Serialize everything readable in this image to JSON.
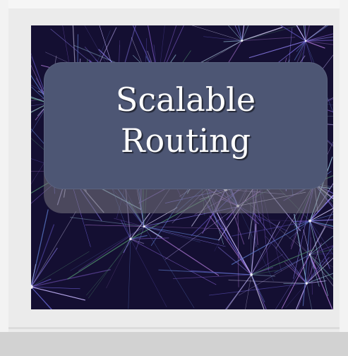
{
  "banner": {
    "line1": "Scalable",
    "line2": "Routing"
  },
  "colors": {
    "background": "#ebebeb",
    "art_background": "#140f32",
    "banner_fill": "#4d5674",
    "title_text": "#ffffff"
  },
  "art": {
    "description_icon": "neural-network-pattern-icon"
  }
}
